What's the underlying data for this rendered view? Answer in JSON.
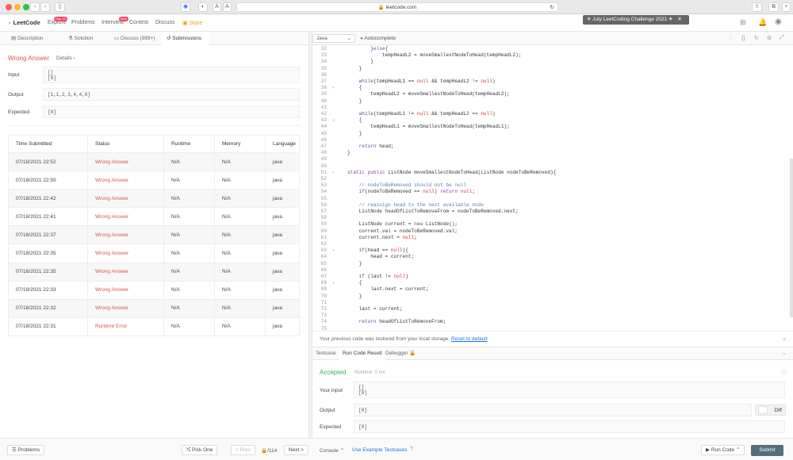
{
  "browser": {
    "url": "leetcode.com",
    "text_size_small": "A",
    "text_size_large": "A"
  },
  "nav": {
    "logo": "LeetCode",
    "items": [
      {
        "label": "Explore",
        "badge": "Day 18"
      },
      {
        "label": "Problems",
        "badge": ""
      },
      {
        "label": "Interview",
        "badge": "New"
      },
      {
        "label": "Contest",
        "badge": ""
      },
      {
        "label": "Discuss",
        "badge": ""
      },
      {
        "label": "Store",
        "badge": ""
      }
    ],
    "promo": "July LeetCoding Challenge 2021"
  },
  "tabs": [
    "Description",
    "Solution",
    "Discuss (999+)",
    "Submissions"
  ],
  "submission": {
    "status": "Wrong Answer",
    "details": "Details",
    "input_label": "Input",
    "input_value": "[]\n[0]",
    "output_label": "Output",
    "output_value": "[1,1,2,3,4,4,0]",
    "expected_label": "Expected",
    "expected_value": "[0]"
  },
  "table": {
    "headers": [
      "Time Submitted",
      "Status",
      "Runtime",
      "Memory",
      "Language"
    ],
    "rows": [
      [
        "07/18/2021 22:52",
        "Wrong Answer",
        "N/A",
        "N/A",
        "java"
      ],
      [
        "07/18/2021 22:50",
        "Wrong Answer",
        "N/A",
        "N/A",
        "java"
      ],
      [
        "07/18/2021 22:42",
        "Wrong Answer",
        "N/A",
        "N/A",
        "java"
      ],
      [
        "07/18/2021 22:41",
        "Wrong Answer",
        "N/A",
        "N/A",
        "java"
      ],
      [
        "07/18/2021 22:37",
        "Wrong Answer",
        "N/A",
        "N/A",
        "java"
      ],
      [
        "07/18/2021 22:35",
        "Wrong Answer",
        "N/A",
        "N/A",
        "java"
      ],
      [
        "07/18/2021 22:35",
        "Wrong Answer",
        "N/A",
        "N/A",
        "java"
      ],
      [
        "07/18/2021 22:33",
        "Wrong Answer",
        "N/A",
        "N/A",
        "java"
      ],
      [
        "07/18/2021 22:32",
        "Wrong Answer",
        "N/A",
        "N/A",
        "java"
      ],
      [
        "07/18/2021 22:31",
        "Runtime Error",
        "N/A",
        "N/A",
        "java"
      ]
    ]
  },
  "editor": {
    "language": "Java",
    "autocomplete": "Autocomplete",
    "lines": [
      {
        "n": "32",
        "t": "        }else{"
      },
      {
        "n": "33",
        "t": "            tempHeadL2 = moveSmallestNodeToHead(tempHeadL2);"
      },
      {
        "n": "34",
        "t": "        }"
      },
      {
        "n": "35",
        "t": "    }"
      },
      {
        "n": "36",
        "t": ""
      },
      {
        "n": "37",
        "t": "    while(tempHeadL1 == null && tempHeadL2 != null)"
      },
      {
        "n": "38",
        "t": "    {"
      },
      {
        "n": "39",
        "t": "        tempHeadL2 = moveSmallestNodeToHead(tempHeadL2);"
      },
      {
        "n": "40",
        "t": "    }"
      },
      {
        "n": "41",
        "t": ""
      },
      {
        "n": "42",
        "t": "    while(tempHeadL1 != null && tempHeadL2 == null)"
      },
      {
        "n": "43",
        "t": "    {"
      },
      {
        "n": "44",
        "t": "        tempHeadL1 = moveSmallestNodeToHead(tempHeadL1);"
      },
      {
        "n": "45",
        "t": "    }"
      },
      {
        "n": "46",
        "t": ""
      },
      {
        "n": "47",
        "t": "    return head;"
      },
      {
        "n": "48",
        "t": "}"
      },
      {
        "n": "49",
        "t": ""
      },
      {
        "n": "50",
        "t": ""
      },
      {
        "n": "51",
        "t": "static public ListNode moveSmallestNodeToHead(ListNode nodeToBeRemoved){"
      },
      {
        "n": "52",
        "t": ""
      },
      {
        "n": "53",
        "t": "    // nodeToBeRemoved should not be null"
      },
      {
        "n": "54",
        "t": "    if(nodeToBeRemoved == null) return null;"
      },
      {
        "n": "55",
        "t": ""
      },
      {
        "n": "56",
        "t": "    // reassign head to the next available node"
      },
      {
        "n": "57",
        "t": "    ListNode headOfListToRemoveFrom = nodeToBeRemoved.next;"
      },
      {
        "n": "58",
        "t": ""
      },
      {
        "n": "59",
        "t": "    ListNode current = new ListNode();"
      },
      {
        "n": "60",
        "t": "    current.val = nodeToBeRemoved.val;"
      },
      {
        "n": "61",
        "t": "    current.next = null;"
      },
      {
        "n": "62",
        "t": ""
      },
      {
        "n": "63",
        "t": "    if(head == null){"
      },
      {
        "n": "64",
        "t": "        head = current;"
      },
      {
        "n": "65",
        "t": "    }"
      },
      {
        "n": "66",
        "t": ""
      },
      {
        "n": "67",
        "t": "    if (last != null)"
      },
      {
        "n": "68",
        "t": "    {"
      },
      {
        "n": "69",
        "t": "        last.next = current;"
      },
      {
        "n": "70",
        "t": "    }"
      },
      {
        "n": "71",
        "t": ""
      },
      {
        "n": "72",
        "t": "    last = current;"
      },
      {
        "n": "73",
        "t": ""
      },
      {
        "n": "74",
        "t": "    return headOfListToRemoveFrom;"
      },
      {
        "n": "75",
        "t": ""
      }
    ]
  },
  "restore": {
    "message": "Your previous code was restored from your local storage.",
    "link": "Reset to default"
  },
  "result_tabs": [
    "Testcase",
    "Run Code Result",
    "Debugger"
  ],
  "run_result": {
    "status": "Accepted",
    "runtime": "Runtime: 0 ms",
    "input_label": "Your input",
    "input_value": "[]\n[0]",
    "output_label": "Output",
    "output_value": "[0]",
    "diff_label": "Diff",
    "expected_label": "Expected",
    "expected_value": "[0]"
  },
  "bottom": {
    "problems": "Problems",
    "pick_one": "Pick One",
    "prev": "< Prev",
    "page": "/114",
    "next": "Next >",
    "console": "Console",
    "use_example": "Use Example Testcases",
    "run_code": "Run Code",
    "submit": "Submit"
  },
  "colors": {
    "wrong": "#d9534f",
    "accepted": "#2db55d",
    "submit_bg": "#546e7a"
  }
}
